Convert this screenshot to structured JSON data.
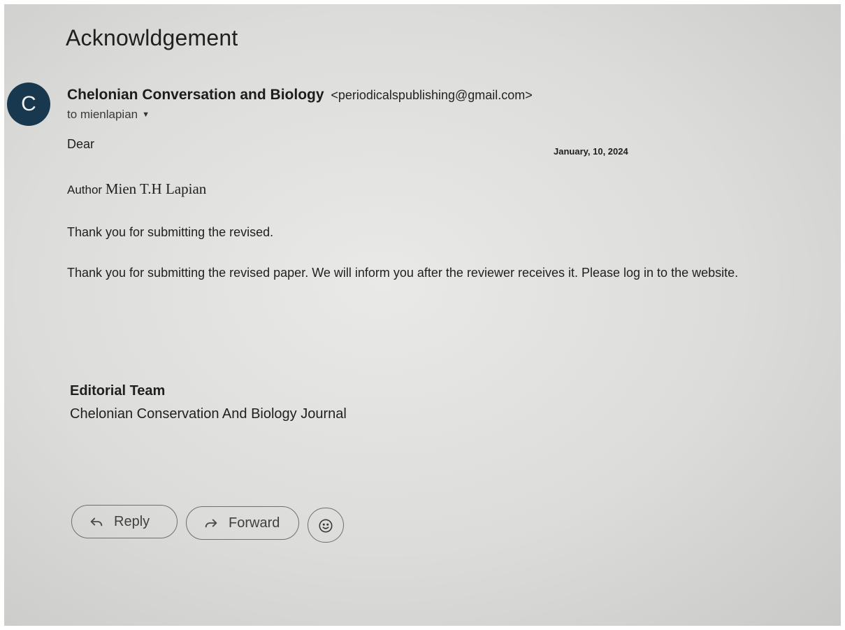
{
  "email": {
    "subject": "Acknowldgement",
    "avatar_letter": "C",
    "sender_name": "Chelonian Conversation and Biology",
    "sender_email": "<periodicalspublishing@gmail.com>",
    "recipient": "to mienlapian",
    "greeting": "Dear",
    "date": "January, 10, 2024",
    "author_prefix": "Author",
    "author_name": "Mien T.H Lapian",
    "line1": "Thank you for submitting the revised.",
    "line2": "Thank you for submitting the revised paper.  We will inform you after the reviewer receives it. Please log in to the website.",
    "signature_team": "Editorial Team",
    "signature_journal": "Chelonian Conservation And Biology Journal"
  },
  "actions": {
    "reply_label": "Reply",
    "forward_label": "Forward"
  },
  "icons": {
    "recipient_dropdown": "caret-down-icon",
    "reply": "reply-arrow-icon",
    "forward": "forward-arrow-icon",
    "emoji": "smiley-face-icon"
  },
  "colors": {
    "avatar_bg": "#17384e",
    "text": "#1f1f1f"
  }
}
